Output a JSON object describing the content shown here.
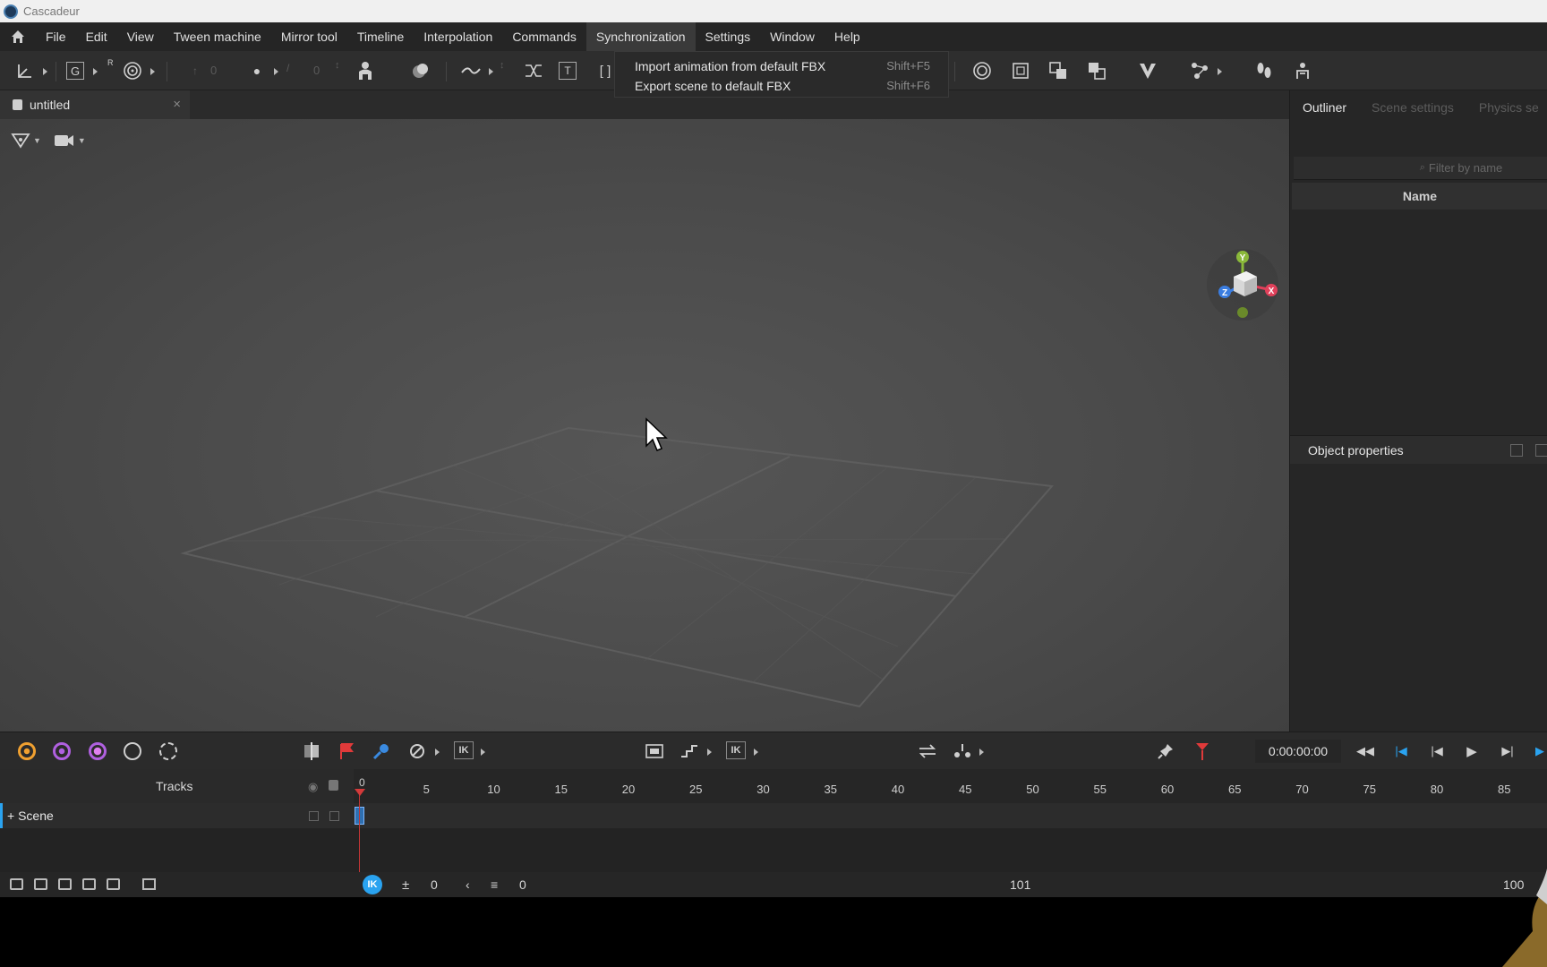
{
  "window": {
    "title": "Cascadeur"
  },
  "menu": {
    "home_icon": "home-icon",
    "items": [
      "File",
      "Edit",
      "View",
      "Tween machine",
      "Mirror tool",
      "Timeline",
      "Interpolation",
      "Commands",
      "Synchronization",
      "Settings",
      "Window",
      "Help"
    ],
    "active": "Synchronization"
  },
  "toolbar": {
    "letters": {
      "g": "G",
      "r": "R",
      "t": "T"
    },
    "numbers": {
      "a": "0",
      "b": "0"
    }
  },
  "dropdown": {
    "items": [
      {
        "label": "Import animation from default FBX",
        "shortcut": "Shift+F5"
      },
      {
        "label": "Export scene to default FBX",
        "shortcut": "Shift+F6"
      }
    ]
  },
  "document": {
    "tab_label": "untitled",
    "close": "×"
  },
  "gizmo": {
    "x": "X",
    "y": "Y",
    "z": "Z",
    "colors": {
      "x": "#e0405a",
      "y": "#8ab83a",
      "z": "#3a7de0"
    }
  },
  "right_panel": {
    "tabs": [
      "Outliner",
      "Scene settings",
      "Physics se"
    ],
    "active_tab": "Outliner",
    "filter_placeholder": "Filter by name",
    "name_column": "Name",
    "object_properties": "Object properties"
  },
  "bottom_toolbar": {
    "ik": "IK",
    "time": "0:00:00:00"
  },
  "timeline": {
    "tracks_label": "Tracks",
    "scene_label": "+ Scene",
    "ruler_zero": "0",
    "ruler_ticks": [
      "5",
      "10",
      "15",
      "20",
      "25",
      "30",
      "35",
      "40",
      "45",
      "50",
      "55",
      "60",
      "65",
      "70",
      "75",
      "80",
      "85"
    ],
    "current_frame": 0
  },
  "footer": {
    "ik": "IK",
    "value_a": "0",
    "value_b": "0",
    "total_frames": "101",
    "end_frame": "100"
  },
  "colors": {
    "accent": "#2aa3f0",
    "playhead": "#d43a3a"
  }
}
